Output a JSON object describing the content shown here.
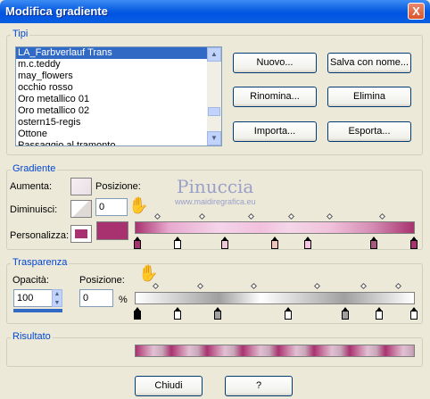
{
  "window": {
    "title": "Modifica gradiente",
    "close_label": "X"
  },
  "tipi": {
    "label": "Tipi",
    "items": [
      "LA_Farbverlauf Trans",
      "m.c.teddy",
      "may_flowers",
      "occhio rosso",
      "Oro metallico 01",
      "Oro metallico 02",
      "ostern15-regis",
      "Ottone",
      "Passaggio al tramonto"
    ],
    "selected_index": 0,
    "buttons": {
      "nuovo": "Nuovo...",
      "salva": "Salva con nome...",
      "rinomina": "Rinomina...",
      "elimina": "Elimina",
      "importa": "Importa...",
      "esporta": "Esporta..."
    }
  },
  "gradiente": {
    "label": "Gradiente",
    "aumenta_label": "Aumenta:",
    "diminuisci_label": "Diminuisci:",
    "personalizza_label": "Personalizza:",
    "posizione_label": "Posizione:",
    "posizione_value": "0",
    "percent": "%",
    "custom_color": "#a8326f",
    "stop_colors": [
      "#a8326f",
      "#ffffff",
      "#ffffff",
      "#f2c7d6",
      "#f3c3b5",
      "#f3c3e3",
      "#a35b7f",
      "#a8326f"
    ]
  },
  "trasparenza": {
    "label": "Trasparenza",
    "opacita_label": "Opacità:",
    "opacita_value": "100",
    "posizione_label": "Posizione:",
    "posizione_value": "0",
    "percent": "%",
    "stop_colors": [
      "#000000",
      "#ffffff",
      "#ffffff",
      "#a0a0a0",
      "#ffffff",
      "#a0a0a0",
      "#ffffff",
      "#ffffff"
    ]
  },
  "risultato": {
    "label": "Risultato"
  },
  "footer": {
    "chiudi": "Chiudi",
    "help": "?"
  },
  "watermark": {
    "name": "Pinuccia",
    "url": "www.maidiregrafica.eu"
  }
}
